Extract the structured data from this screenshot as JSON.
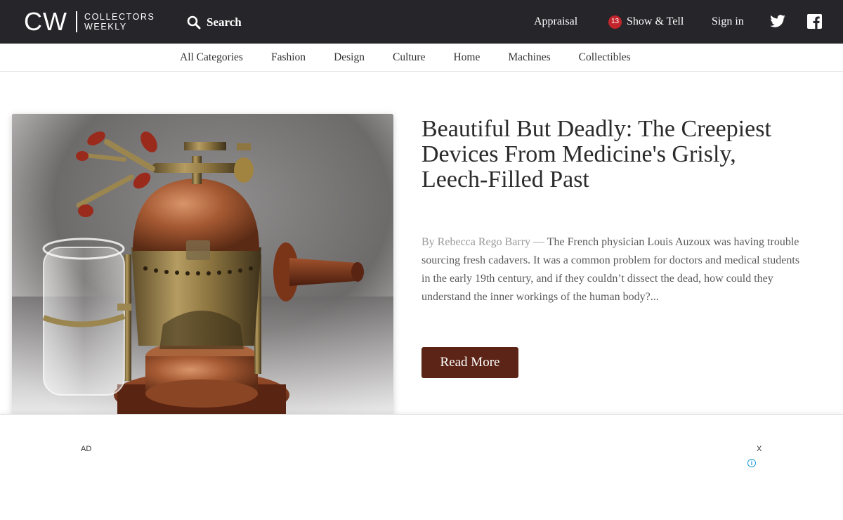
{
  "header": {
    "logo_mark": "CW",
    "logo_line1": "COLLECTORS",
    "logo_line2": "WEEKLY",
    "search_label": "Search",
    "appraisal_label": "Appraisal",
    "show_tell_count": "13",
    "show_tell_label": "Show & Tell",
    "signin_label": "Sign in",
    "twitter_icon": "twitter-icon",
    "facebook_icon": "facebook-icon"
  },
  "categories": [
    "All Categories",
    "Fashion",
    "Design",
    "Culture",
    "Home",
    "Machines",
    "Collectibles"
  ],
  "article": {
    "title": "Beautiful But Deadly: The Creepiest Devices From Medicine's Grisly, Leech-Filled Past",
    "byline": "By Rebecca Rego Barry —",
    "excerpt": " The French physician Louis Auzoux was having trouble sourcing fresh cadavers. It was a common problem for doctors and medical students in the early 19th century, and if they couldn’t dissect the dead, how could they understand the inner workings of the human body?...",
    "read_more_label": "Read More"
  },
  "ad": {
    "label": "AD",
    "close_label": "X",
    "info_label": "i"
  },
  "colors": {
    "topbar": "#25252a",
    "badge": "#c3252c",
    "read_more_bg": "#5b2416",
    "info": "#1a9bd7"
  }
}
